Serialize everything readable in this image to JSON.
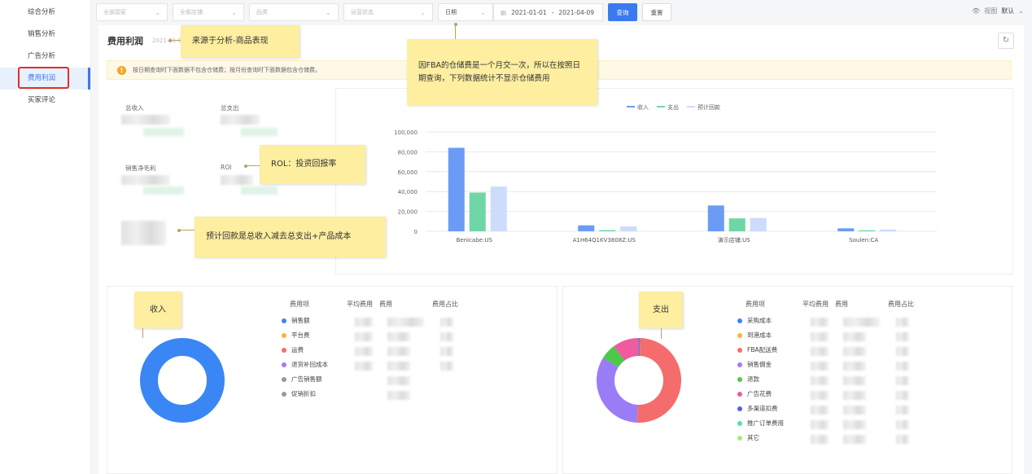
{
  "sidebar": {
    "items": [
      {
        "label": "综合分析",
        "active": false
      },
      {
        "label": "销售分析",
        "active": false
      },
      {
        "label": "广告分析",
        "active": false
      },
      {
        "label": "费用利润",
        "active": true
      },
      {
        "label": "买家评论",
        "active": false
      }
    ]
  },
  "toolbar": {
    "country_placeholder": "全部国家",
    "store_placeholder": "全部店铺",
    "category_placeholder": "品类",
    "status_placeholder": "运营状态",
    "date_type": "日期",
    "date_start": "2021-01-01",
    "date_sep": "-",
    "date_end": "2021-04-09",
    "query_label": "查询",
    "reset_label": "重置",
    "view_label": "视图",
    "view_value": "默认"
  },
  "panel": {
    "title": "费用利润",
    "date_text": "2021-01-0",
    "notice": "按日期查询时下面数据不包含仓储费；按月份查询时下面数据包含仓储费。"
  },
  "kpis": [
    {
      "label": "总收入"
    },
    {
      "label": "总支出"
    },
    {
      "label": "销售净毛利"
    },
    {
      "label": "ROI"
    }
  ],
  "annotations": {
    "source": "来源于分析-商品表现",
    "fba": "因FBA的仓储费是一个月交一次，所以在按照日期查询，下列数据统计不显示仓储费用",
    "roi": "ROL：投资回报率",
    "payback": "预计回款是总收入减去总支出+产品成本",
    "income": "收入",
    "expense": "支出"
  },
  "chart_data": [
    {
      "type": "bar",
      "title": "",
      "categories": [
        "Benicabe:US",
        "A1H64Q1KV3808Z:US",
        "演示店铺:US",
        "Soulen:CA"
      ],
      "series": [
        {
          "name": "收入",
          "color": "#6b9bf5",
          "values": [
            84000,
            6000,
            26000,
            3000
          ]
        },
        {
          "name": "支出",
          "color": "#6fd6a7",
          "values": [
            39000,
            1200,
            13000,
            1000
          ]
        },
        {
          "name": "预计回款",
          "color": "#cddcfb",
          "values": [
            45000,
            5000,
            13500,
            1800
          ]
        }
      ],
      "yticks": [
        "0",
        "20,000",
        "40,000",
        "60,000",
        "80,000",
        "100,000"
      ],
      "ylim": [
        0,
        100000
      ],
      "legend": "top-center",
      "grid": true
    },
    {
      "type": "pie",
      "title": "收入",
      "labels": [
        "销售额",
        "平台费",
        "运费",
        "退货补回成本",
        "广告销售额",
        "促销折扣"
      ],
      "colors": [
        "#3a86f5",
        "#f5b82e",
        "#f56c6c",
        "#9b7cf7",
        "#999999",
        "#999999"
      ],
      "values": [
        100,
        0,
        0,
        0,
        0,
        0
      ]
    },
    {
      "type": "pie",
      "title": "支出",
      "labels": [
        "采购成本",
        "到港成本",
        "FBA配送费",
        "销售佣金",
        "退款",
        "广告花费",
        "多渠道扣费",
        "推广订单费用",
        "其它"
      ],
      "colors": [
        "#3a86f5",
        "#f5b82e",
        "#f56c6c",
        "#9b7cf7",
        "#4cc94c",
        "#ef5b9c",
        "#5b5be8",
        "#5fd8b6",
        "#9ef07a"
      ],
      "values": [
        0.5,
        0,
        50,
        33,
        6,
        10,
        0,
        0,
        0
      ]
    }
  ],
  "breakdown": {
    "headers": [
      "费用项",
      "平均费用",
      "费用",
      "费用占比"
    ]
  }
}
